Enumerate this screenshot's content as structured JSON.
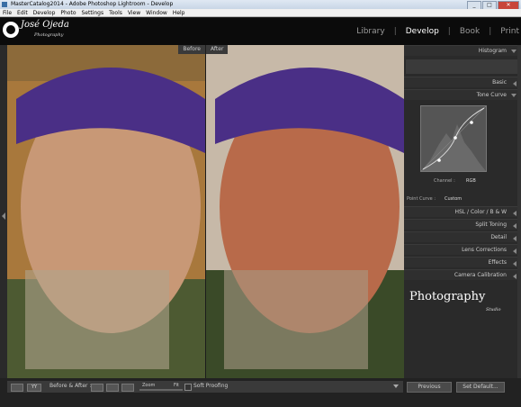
{
  "window": {
    "title": "MasterCatalog2014 - Adobe Photoshop Lightroom - Develop"
  },
  "menu": [
    "File",
    "Edit",
    "Develop",
    "Photo",
    "Settings",
    "Tools",
    "View",
    "Window",
    "Help"
  ],
  "identity_plate": {
    "name": "José Ojeda",
    "sub": "Photography"
  },
  "modules": [
    "Library",
    "Develop",
    "Book",
    "Print"
  ],
  "photos": {
    "before_label": "Before",
    "after_label": "After"
  },
  "panels": {
    "histogram": "Histogram",
    "basic": "Basic",
    "tone_curve": "Tone Curve",
    "channel_label": "Channel :",
    "channel_value": "RGB",
    "point_curve_label": "Point Curve :",
    "point_curve_value": "Custom",
    "hsl": "HSL / Color / B & W",
    "split_toning": "Split Toning",
    "detail": "Detail",
    "lens_corrections": "Lens Corrections",
    "effects": "Effects",
    "camera_calibration": "Camera Calibration"
  },
  "watermark": {
    "text": "Photography",
    "sub": "Studio"
  },
  "toolbar": {
    "before_after": "Before & After :",
    "zoom": "Zoom",
    "zoom_value": "Fit",
    "soft_proofing": "Soft Proofing"
  },
  "buttons": {
    "previous": "Previous",
    "set_default": "Set Default..."
  }
}
